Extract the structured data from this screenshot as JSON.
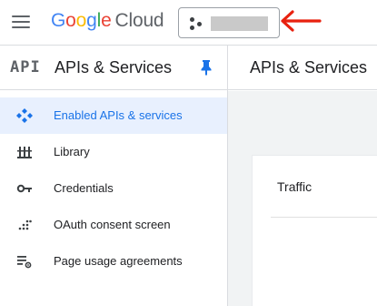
{
  "topbar": {
    "logo_letters": [
      "G",
      "o",
      "o",
      "g",
      "l",
      "e"
    ],
    "logo_product": "Cloud"
  },
  "sidebar": {
    "badge": "API",
    "title": "APIs & Services",
    "items": [
      {
        "label": "Enabled APIs & services",
        "icon": "enabled-apis-icon",
        "active": true
      },
      {
        "label": "Library",
        "icon": "library-icon",
        "active": false
      },
      {
        "label": "Credentials",
        "icon": "key-icon",
        "active": false
      },
      {
        "label": "OAuth consent screen",
        "icon": "oauth-consent-icon",
        "active": false
      },
      {
        "label": "Page usage agreements",
        "icon": "page-usage-settings-icon",
        "active": false
      }
    ]
  },
  "main": {
    "title": "APIs & Services",
    "card_title": "Traffic"
  },
  "colors": {
    "accent": "#1a73e8",
    "active_bg": "#e8f0fe",
    "annotation_arrow": "#e8210f",
    "border": "#dadce0"
  }
}
